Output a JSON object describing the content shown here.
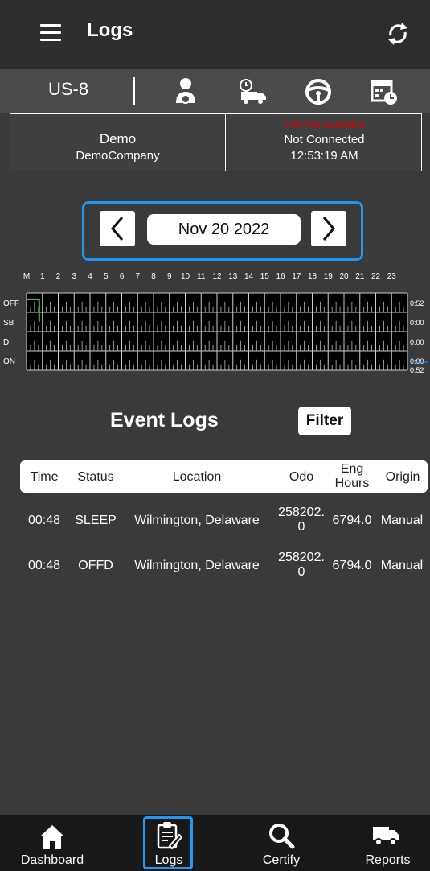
{
  "header": {
    "title": "Logs"
  },
  "subbar": {
    "ruleset": "US-8",
    "icons": [
      "driver-icon",
      "truck-clock-icon",
      "steering-wheel-icon",
      "calendar-clock-icon"
    ]
  },
  "info": {
    "driver_name": "Demo",
    "company": "DemoCompany",
    "vin_status": "VIN Not Available",
    "connection": "Not Connected",
    "time": "12:53:19 AM",
    "vin_color": "#d00000"
  },
  "date_nav": {
    "date": "Nov 20 2022",
    "accent": "#2196f3"
  },
  "graph": {
    "hour_labels": [
      "M",
      "1",
      "2",
      "3",
      "4",
      "5",
      "6",
      "7",
      "8",
      "9",
      "10",
      "11",
      "12",
      "13",
      "14",
      "15",
      "16",
      "17",
      "18",
      "19",
      "20",
      "21",
      "22",
      "23"
    ],
    "rows": [
      {
        "label": "OFF",
        "total": "0:52"
      },
      {
        "label": "SB",
        "total": "0:00"
      },
      {
        "label": "D",
        "total": "0:00"
      },
      {
        "label": "ON",
        "total": "0:00"
      }
    ],
    "grand_total": "0:52",
    "line_color": "#2ecc40"
  },
  "events": {
    "title": "Event Logs",
    "filter_label": "Filter",
    "columns": {
      "time": "Time",
      "status": "Status",
      "location": "Location",
      "odo": "Odo",
      "eng_hours_1": "Eng",
      "eng_hours_2": "Hours",
      "origin": "Origin"
    },
    "rows": [
      {
        "time": "00:48",
        "status": "SLEEP",
        "location": "Wilmington, Delaware",
        "odo_1": "258202.",
        "odo_2": "0",
        "eng_hours": "6794.0",
        "origin": "Manual"
      },
      {
        "time": "00:48",
        "status": "OFFD",
        "location": "Wilmington, Delaware",
        "odo_1": "258202.",
        "odo_2": "0",
        "eng_hours": "6794.0",
        "origin": "Manual"
      }
    ]
  },
  "nav": {
    "items": [
      {
        "label": "Dashboard",
        "icon": "home-icon"
      },
      {
        "label": "Logs",
        "icon": "clipboard-icon"
      },
      {
        "label": "Certify",
        "icon": "search-icon"
      },
      {
        "label": "Reports",
        "icon": "truck-icon"
      }
    ],
    "active": "Logs"
  }
}
